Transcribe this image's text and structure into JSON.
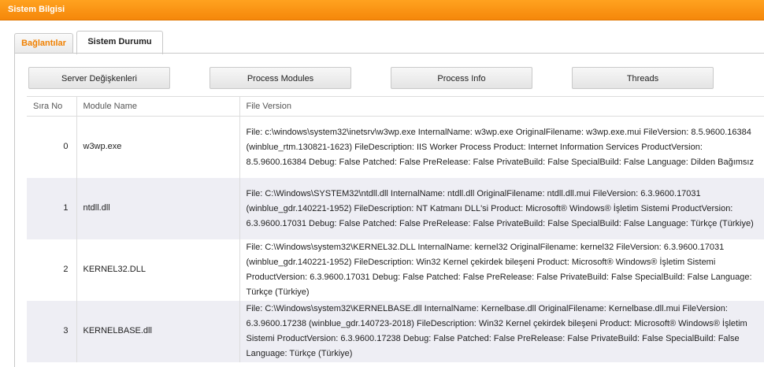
{
  "header": {
    "title": "Sistem Bilgisi"
  },
  "tabs": [
    {
      "label": "Bağlantılar",
      "active": false
    },
    {
      "label": "Sistem Durumu",
      "active": true
    }
  ],
  "toolbar": {
    "server_vars_label": "Server Değişkenleri",
    "process_modules_label": "Process Modules",
    "process_info_label": "Process Info",
    "threads_label": "Threads"
  },
  "table": {
    "columns": [
      "Sıra No",
      "Module Name",
      "File Version"
    ],
    "rows": [
      {
        "index": "0",
        "name": "w3wp.exe",
        "version": "File: c:\\windows\\system32\\inetsrv\\w3wp.exe InternalName: w3wp.exe OriginalFilename: w3wp.exe.mui FileVersion: 8.5.9600.16384 (winblue_rtm.130821-1623) FileDescription: IIS Worker Process Product: Internet Information Services ProductVersion: 8.5.9600.16384 Debug: False Patched: False PreRelease: False PrivateBuild: False SpecialBuild: False Language: Dilden Bağımsız"
      },
      {
        "index": "1",
        "name": "ntdll.dll",
        "version": "File: C:\\Windows\\SYSTEM32\\ntdll.dll InternalName: ntdll.dll OriginalFilename: ntdll.dll.mui FileVersion: 6.3.9600.17031 (winblue_gdr.140221-1952) FileDescription: NT Katmanı DLL'si Product: Microsoft® Windows® İşletim Sistemi ProductVersion: 6.3.9600.17031 Debug: False Patched: False PreRelease: False PrivateBuild: False SpecialBuild: False Language: Türkçe (Türkiye)"
      },
      {
        "index": "2",
        "name": "KERNEL32.DLL",
        "version": "File: C:\\Windows\\system32\\KERNEL32.DLL InternalName: kernel32 OriginalFilename: kernel32 FileVersion: 6.3.9600.17031 (winblue_gdr.140221-1952) FileDescription: Win32 Kernel çekirdek bileşeni Product: Microsoft® Windows® İşletim Sistemi ProductVersion: 6.3.9600.17031 Debug: False Patched: False PreRelease: False PrivateBuild: False SpecialBuild: False Language: Türkçe (Türkiye)"
      },
      {
        "index": "3",
        "name": "KERNELBASE.dll",
        "version": "File: C:\\Windows\\system32\\KERNELBASE.dll InternalName: Kernelbase.dll OriginalFilename: Kernelbase.dll.mui FileVersion: 6.3.9600.17238 (winblue_gdr.140723-2018) FileDescription: Win32 Kernel çekirdek bileşeni Product: Microsoft® Windows® İşletim Sistemi ProductVersion: 6.3.9600.17238 Debug: False Patched: False PreRelease: False PrivateBuild: False SpecialBuild: False Language: Türkçe (Türkiye)"
      }
    ]
  }
}
